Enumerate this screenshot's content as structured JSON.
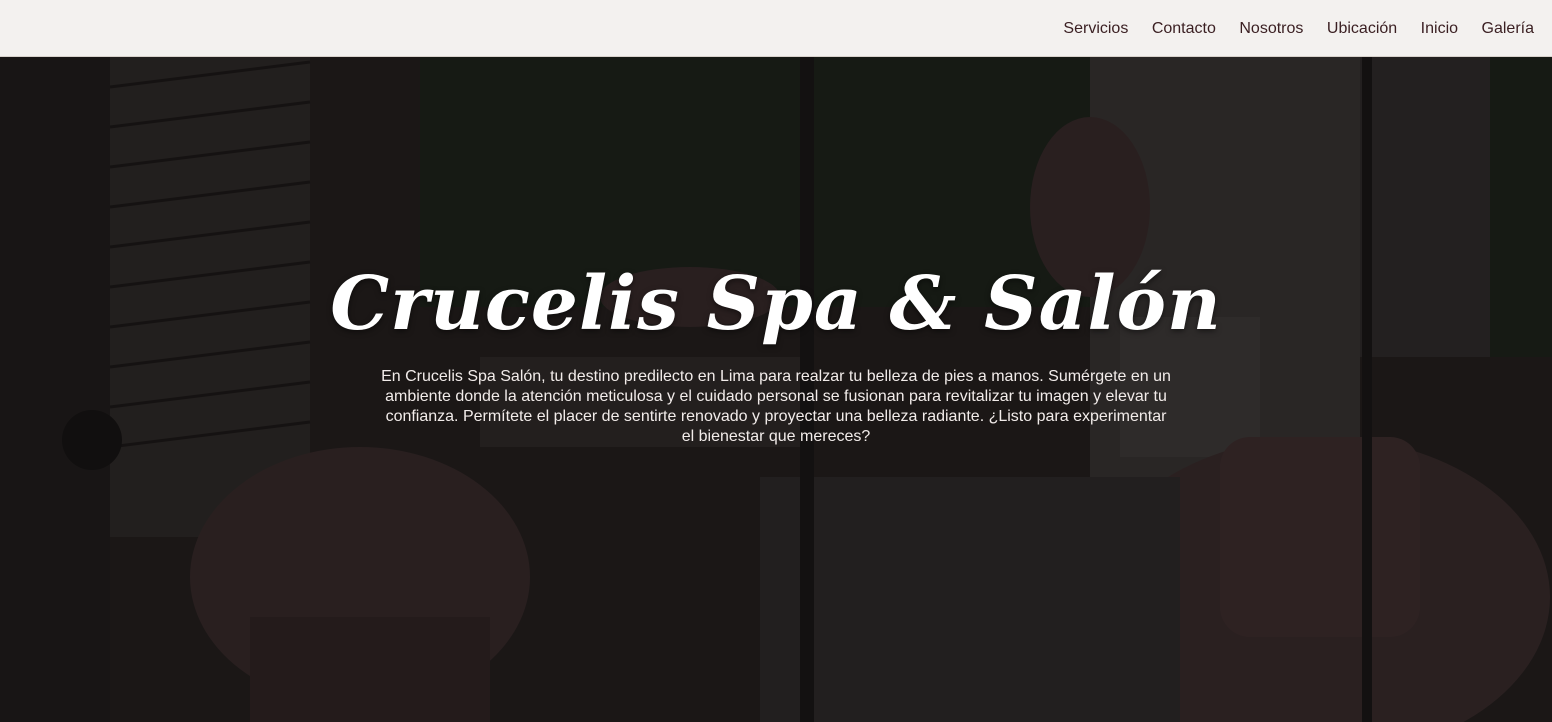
{
  "nav": {
    "items": [
      {
        "label": "Servicios"
      },
      {
        "label": "Contacto"
      },
      {
        "label": "Nosotros"
      },
      {
        "label": "Ubicación"
      },
      {
        "label": "Inicio"
      },
      {
        "label": "Galería"
      }
    ]
  },
  "hero": {
    "title": "Crucelis Spa & Salón",
    "description": "En Crucelis Spa Salón, tu destino predilecto en Lima para realzar tu belleza de pies a manos. Sumérgete en un ambiente donde la atención meticulosa y el cuidado personal se fusionan para revitalizar tu imagen y elevar tu confianza. Permítete el placer de sentirte renovado y proyectar una belleza radiante. ¿Listo para experimentar el bienestar que mereces?"
  },
  "colors": {
    "nav_background": "#f3f1ef",
    "nav_text": "#3a1f22",
    "hero_text": "#ffffff",
    "hero_overlay": "#0f0c0c"
  }
}
